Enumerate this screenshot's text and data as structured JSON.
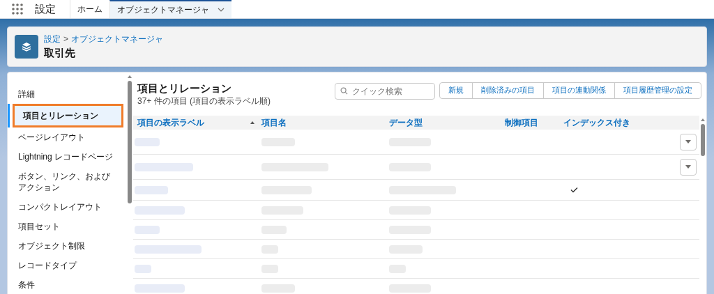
{
  "app_title": "設定",
  "nav_tabs": [
    {
      "label": "ホーム",
      "selected": false,
      "has_menu": false
    },
    {
      "label": "オブジェクトマネージャ",
      "selected": true,
      "has_menu": true
    }
  ],
  "header": {
    "breadcrumb": [
      "設定",
      "オブジェクトマネージャ"
    ],
    "separator": ">",
    "title": "取引先"
  },
  "sidebar": {
    "items": [
      {
        "label": "詳細",
        "selected": false
      },
      {
        "label": "項目とリレーション",
        "selected": true
      },
      {
        "label": "ページレイアウト",
        "selected": false
      },
      {
        "label": "Lightning レコードページ",
        "selected": false
      },
      {
        "label": "ボタン、リンク、およびアクション",
        "selected": false
      },
      {
        "label": "コンパクトレイアウト",
        "selected": false
      },
      {
        "label": "項目セット",
        "selected": false
      },
      {
        "label": "オブジェクト制限",
        "selected": false
      },
      {
        "label": "レコードタイプ",
        "selected": false
      },
      {
        "label": "条件",
        "selected": false
      }
    ]
  },
  "panel": {
    "title": "項目とリレーション",
    "subtitle": "37+ 件の項目 (項目の表示ラベル順)",
    "search": {
      "placeholder": "クイック検索"
    },
    "buttons": [
      "新規",
      "削除済みの項目",
      "項目の連動関係",
      "項目履歴管理の設定"
    ]
  },
  "table": {
    "columns": [
      {
        "label": "項目の表示ラベル",
        "sorted": true
      },
      {
        "label": "項目名",
        "sorted": false
      },
      {
        "label": "データ型",
        "sorted": false
      },
      {
        "label": "制御項目",
        "sorted": false
      },
      {
        "label": "インデックス付き",
        "sorted": false
      }
    ],
    "rows": [
      {
        "indexed": false,
        "has_menu": true
      },
      {
        "indexed": false,
        "has_menu": true
      },
      {
        "indexed": true,
        "has_menu": false
      },
      {
        "indexed": false,
        "has_menu": false
      },
      {
        "indexed": false,
        "has_menu": false
      },
      {
        "indexed": false,
        "has_menu": false
      },
      {
        "indexed": false,
        "has_menu": false
      },
      {
        "indexed": false,
        "has_menu": false
      }
    ]
  }
}
